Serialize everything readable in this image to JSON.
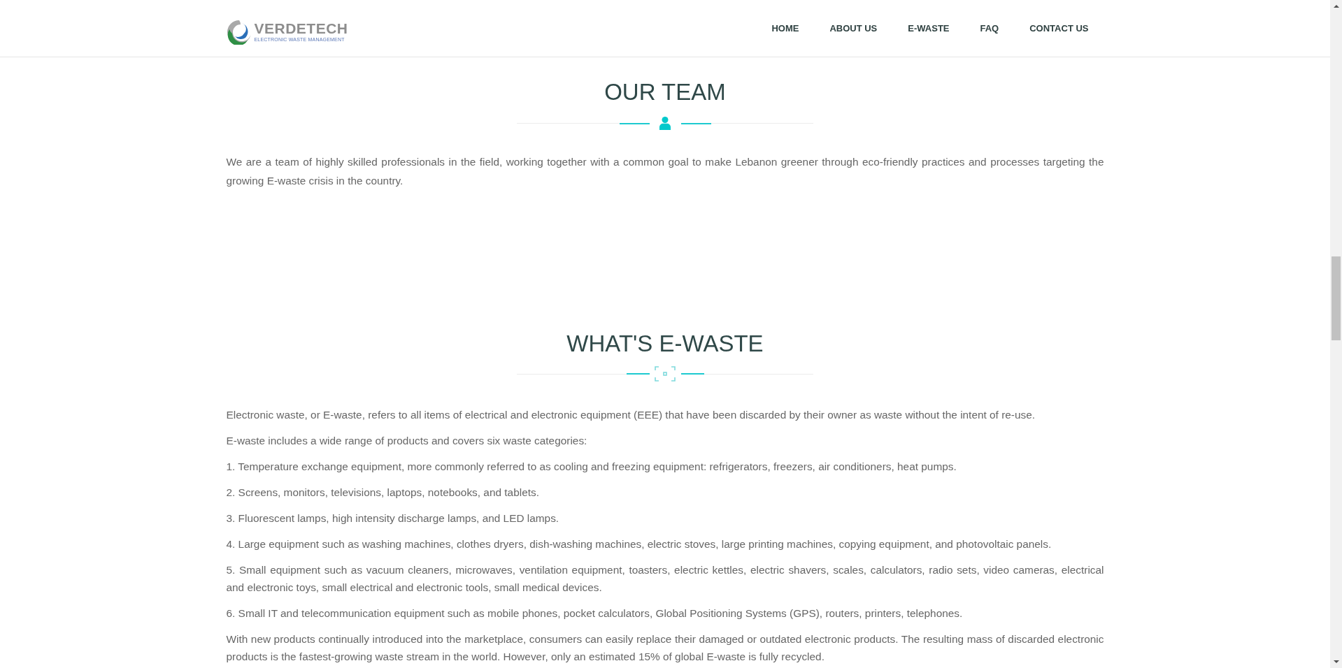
{
  "header": {
    "logo": {
      "name": "VERDETECH",
      "tagline": "ELECTRONIC WASTE MANAGEMENT"
    },
    "nav": [
      {
        "label": "HOME"
      },
      {
        "label": "ABOUT US"
      },
      {
        "label": "E-WASTE"
      },
      {
        "label": "FAQ"
      },
      {
        "label": "CONTACT US"
      }
    ]
  },
  "sections": [
    {
      "title": "OUR TEAM",
      "divider": {
        "kind": "person"
      },
      "paragraphs": [
        "We are a team of highly skilled professionals in the field, working together with a common goal to make Lebanon greener through eco-friendly practices and processes targeting the growing E-waste crisis in the country."
      ]
    },
    {
      "title": "WHAT'S E-WASTE",
      "divider": {
        "kind": "frame"
      },
      "paragraphs": [
        "Electronic waste, or E-waste, refers to all items of electrical and electronic equipment (EEE) that have been discarded by their owner as waste without the intent of re-use.",
        "E-waste includes a wide range of products and covers six waste categories:",
        "1. Temperature exchange equipment, more commonly referred to as cooling and freezing equipment: refrigerators, freezers, air conditioners, heat pumps.",
        "2. Screens, monitors, televisions, laptops, notebooks, and tablets.",
        "3. Fluorescent lamps, high intensity discharge lamps, and LED lamps.",
        "4. Large equipment such as washing machines, clothes dryers, dish-washing machines, electric stoves, large printing machines, copying equipment, and photovoltaic panels.",
        "5. Small equipment such as vacuum cleaners, microwaves, ventilation equipment, toasters, electric kettles, electric shavers, scales, calculators, radio sets, video cameras, electrical and electronic toys, small electrical and electronic tools, small medical devices.",
        "6. Small IT and telecommunication equipment such as mobile phones, pocket calculators, Global Positioning Systems (GPS), routers, printers, telephones.",
        "With new products continually introduced into the marketplace, consumers can easily replace their damaged or outdated electronic products. The resulting mass of discarded electronic products is the fastest-growing waste stream in the world. However, only an estimated 15% of global E-waste is fully recycled."
      ]
    }
  ]
}
